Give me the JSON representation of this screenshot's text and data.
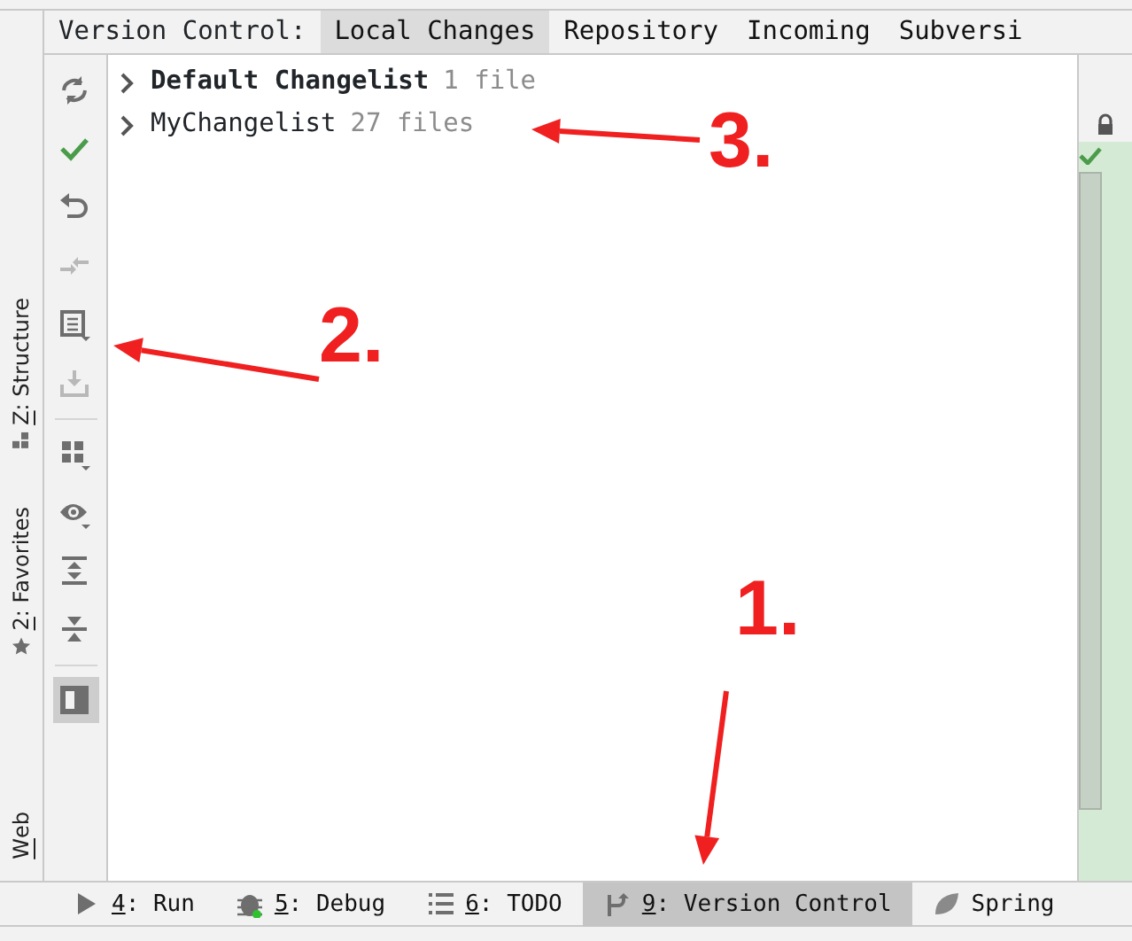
{
  "tool_window": {
    "title": "Version Control:",
    "tabs": [
      {
        "label": "Local Changes",
        "selected": true
      },
      {
        "label": "Repository",
        "selected": false
      },
      {
        "label": "Incoming",
        "selected": false
      },
      {
        "label": "Subversi",
        "selected": false
      }
    ]
  },
  "left_stripe": [
    {
      "label": "Z: Structure",
      "kind": "structure"
    },
    {
      "label": "2: Favorites",
      "kind": "favorites"
    },
    {
      "label": "Web",
      "kind": "web"
    }
  ],
  "toolbar": [
    {
      "kind": "refresh",
      "disabled": false,
      "selected": false
    },
    {
      "kind": "commit",
      "disabled": false
    },
    {
      "kind": "rollback",
      "disabled": false,
      "selected": false
    },
    {
      "kind": "diff",
      "disabled": true,
      "selected": false
    },
    {
      "kind": "changelist",
      "disabled": false,
      "selected": false
    },
    {
      "kind": "shelve",
      "disabled": true,
      "selected": false
    },
    {
      "kind": "separator"
    },
    {
      "kind": "group",
      "disabled": false,
      "selected": false
    },
    {
      "kind": "view",
      "disabled": false,
      "selected": false
    },
    {
      "kind": "expand",
      "disabled": false,
      "selected": false
    },
    {
      "kind": "collapse",
      "disabled": false,
      "selected": false
    },
    {
      "kind": "separator"
    },
    {
      "kind": "preview",
      "disabled": false,
      "selected": true
    }
  ],
  "changelists": [
    {
      "name": "Default Changelist",
      "count": "1 file",
      "active": true,
      "expanded": false
    },
    {
      "name": "MyChangelist",
      "count": "27 files",
      "active": false,
      "expanded": false
    }
  ],
  "bottom_tabs": [
    {
      "label": "4: Run",
      "kind": "run",
      "selected": false
    },
    {
      "label": "5: Debug",
      "kind": "debug",
      "selected": false
    },
    {
      "label": "6: TODO",
      "kind": "todo",
      "selected": false
    },
    {
      "label": "9: Version Control",
      "kind": "vcs",
      "selected": true
    },
    {
      "label": "Spring",
      "kind": "spring",
      "selected": false
    }
  ],
  "annotations": [
    {
      "label": "1."
    },
    {
      "label": "2."
    },
    {
      "label": "3."
    }
  ]
}
